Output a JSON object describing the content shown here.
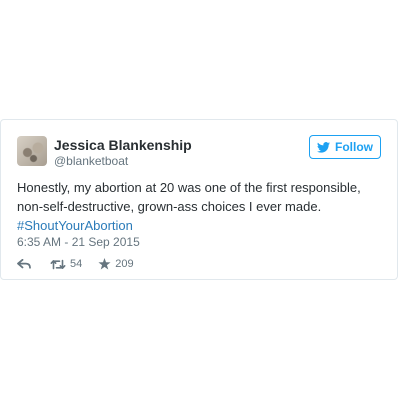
{
  "tweet": {
    "author_name": "Jessica Blankenship",
    "author_handle": "@blanketboat",
    "follow_label": "Follow",
    "text": "Honestly, my abortion at 20 was one of the first responsible, non-self-destructive, grown-ass choices I ever made.",
    "hashtag": "#ShoutYourAbortion",
    "timestamp": "6:35 AM - 21 Sep 2015",
    "retweet_count": "54",
    "like_count": "209"
  },
  "icons": {
    "follow": "bird-icon",
    "reply": "reply-icon",
    "retweet": "retweet-icon",
    "like": "star-icon"
  },
  "colors": {
    "accent": "#1da1f2",
    "hashtag": "#2b7bb9",
    "text": "#292f33",
    "muted": "#66757f",
    "border": "#e1e8ed"
  }
}
